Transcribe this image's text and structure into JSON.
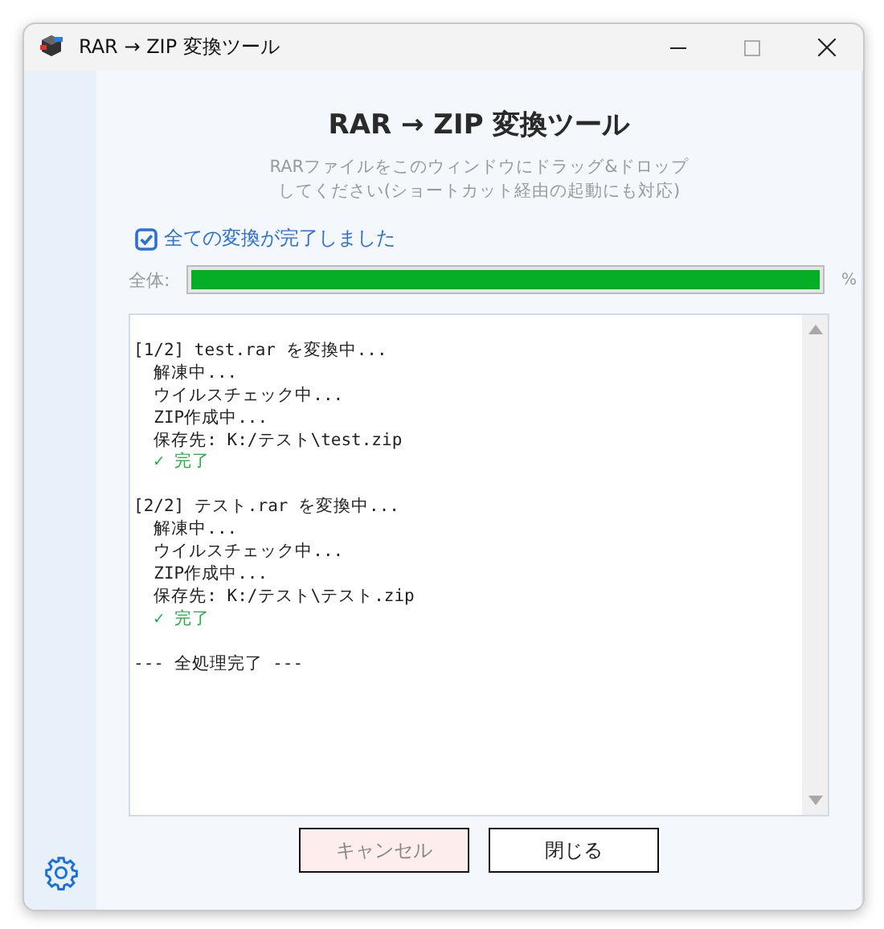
{
  "window": {
    "title": "RAR → ZIP 変換ツール"
  },
  "heading": "RAR → ZIP 変換ツール",
  "instructions": [
    "RARファイルをこのウィンドウにドラッグ&ドロップ",
    "してください(ショートカット経由の起動にも対応)"
  ],
  "status": {
    "label": "全ての変換が完了しました",
    "checked": true
  },
  "progress": {
    "label": "全体:",
    "level": 1,
    "reading": "%"
  },
  "log": [
    {
      "kind": "blank"
    },
    {
      "kind": "header",
      "text": "[1/2] test.rar を変換中..."
    },
    {
      "kind": "step",
      "text": "  解凍中..."
    },
    {
      "kind": "step",
      "text": "  ウイルスチェック中..."
    },
    {
      "kind": "step",
      "text": "  ZIP作成中..."
    },
    {
      "kind": "step",
      "text": "  保存先: K:/テスト\\test.zip"
    },
    {
      "kind": "done",
      "text": "  ✓ 完了"
    },
    {
      "kind": "blank"
    },
    {
      "kind": "header",
      "text": "[2/2] テスト.rar を変換中..."
    },
    {
      "kind": "step",
      "text": "  解凍中..."
    },
    {
      "kind": "step",
      "text": "  ウイルスチェック中..."
    },
    {
      "kind": "step",
      "text": "  ZIP作成中..."
    },
    {
      "kind": "step",
      "text": "  保存先: K:/テスト\\テスト.zip"
    },
    {
      "kind": "done",
      "text": "  ✓ 完了"
    },
    {
      "kind": "blank"
    },
    {
      "kind": "footer",
      "text": "--- 全処理完了 ---"
    }
  ],
  "buttons": [
    {
      "label": "キャンセル",
      "disabled": true
    },
    {
      "label": "閉じる",
      "disabled": false
    }
  ]
}
